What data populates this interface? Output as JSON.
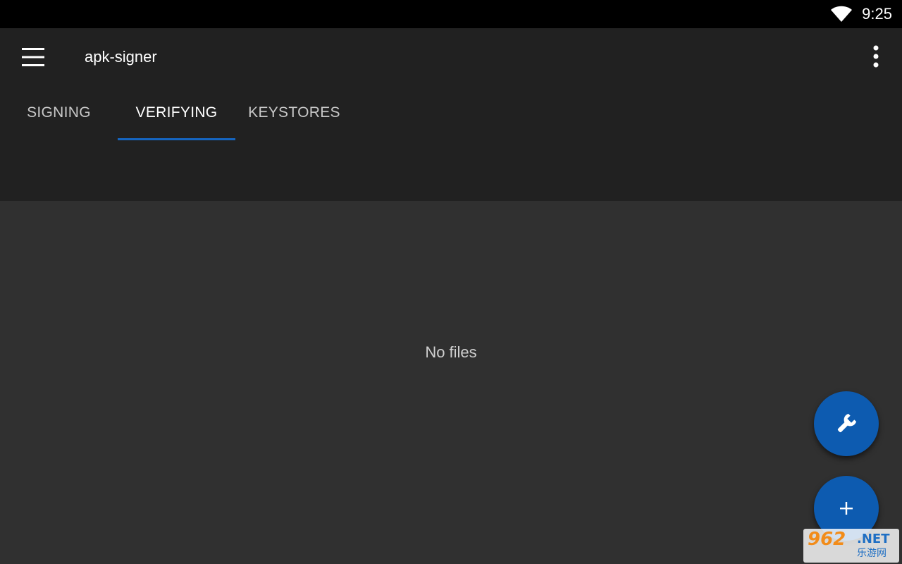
{
  "status_bar": {
    "time": "9:25",
    "wifi_icon": "wifi-icon"
  },
  "app_bar": {
    "title": "apk-signer",
    "menu_icon": "hamburger-menu-icon",
    "overflow_icon": "more-vert-icon"
  },
  "tabs": [
    {
      "label": "SIGNING",
      "active": false
    },
    {
      "label": "VERIFYING",
      "active": true
    },
    {
      "label": "KEYSTORES",
      "active": false
    }
  ],
  "content": {
    "empty_text": "No files"
  },
  "fabs": [
    {
      "icon": "wrench-icon"
    },
    {
      "icon": "plus-icon"
    }
  ],
  "watermark": {
    "number": "962",
    "net": ".NET",
    "subtitle": "乐游网"
  },
  "colors": {
    "status_bar": "#000000",
    "app_bar": "#212121",
    "background": "#303030",
    "accent": "#1565c0",
    "fab": "#0d5bb0"
  }
}
